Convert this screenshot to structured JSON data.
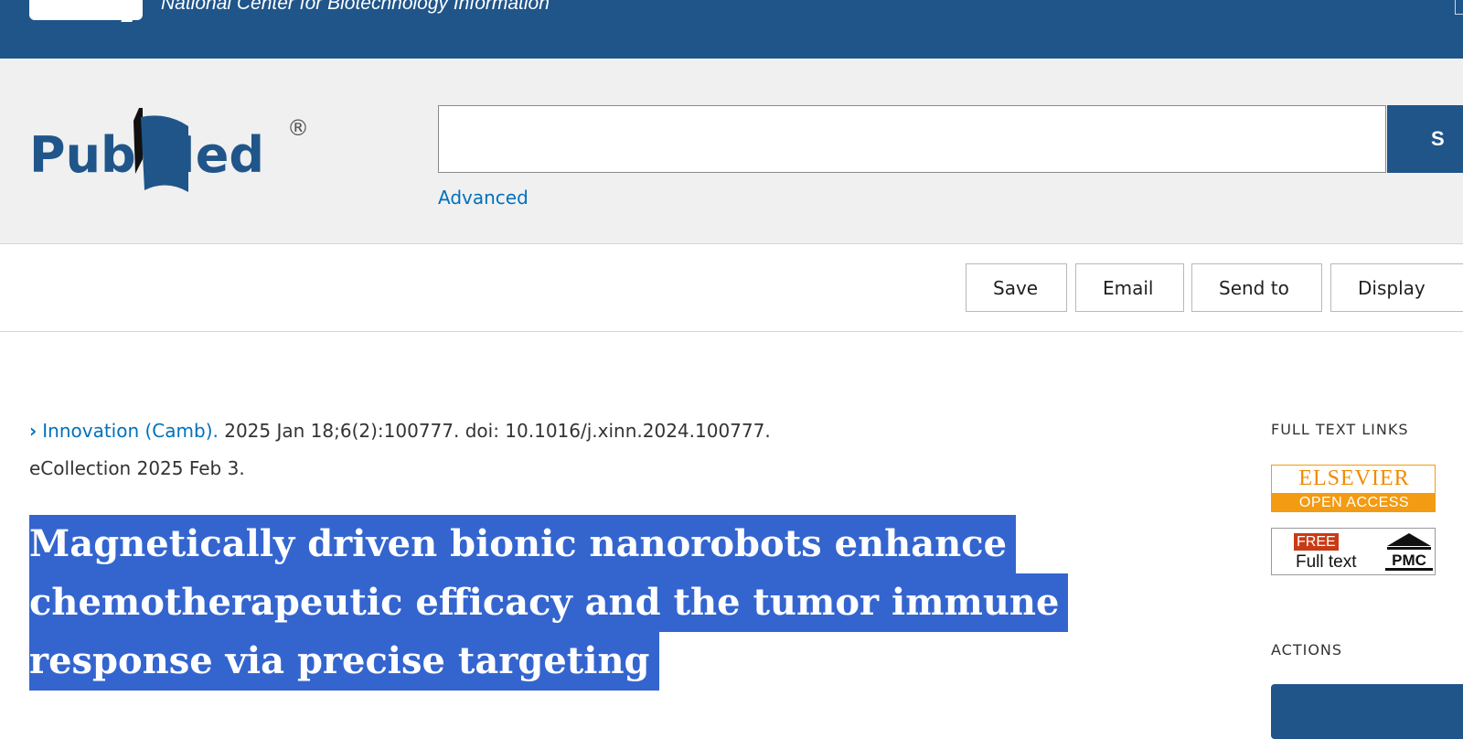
{
  "ncbi": {
    "tagline": "National Center for Biotechnology Information"
  },
  "pubmed": {
    "logo_text_left": "Pub",
    "logo_text_right": "Med",
    "registered": "®",
    "search_placeholder": "",
    "search_button_label": "S",
    "advanced_label": "Advanced"
  },
  "toolbar": {
    "save_label": "Save",
    "email_label": "Email",
    "send_to_label": "Send to",
    "display_label": "Display"
  },
  "article": {
    "journal": "Innovation (Camb).",
    "citation_rest": " 2025 Jan 18;6(2):100777. doi: 10.1016/j.xinn.2024.100777.",
    "ecollection": "eCollection 2025 Feb 3.",
    "title_lines": [
      "Magnetically driven bionic nanorobots enhance",
      "chemotherapeutic efficacy and the tumor immune",
      "response via precise targeting"
    ]
  },
  "sidebar": {
    "full_text_links_heading": "FULL TEXT LINKS",
    "elsevier_name": "ELSEVIER",
    "elsevier_badge_text": "OPEN ACCESS",
    "pmc_free": "FREE",
    "pmc_full_text": "Full text",
    "pmc_label": "PMC",
    "actions_heading": "ACTIONS"
  },
  "colors": {
    "ncbi_blue": "#20558a",
    "link_blue": "#0071bc",
    "selection_highlight": "#3465cf",
    "elsevier_orange": "#f29b13"
  }
}
